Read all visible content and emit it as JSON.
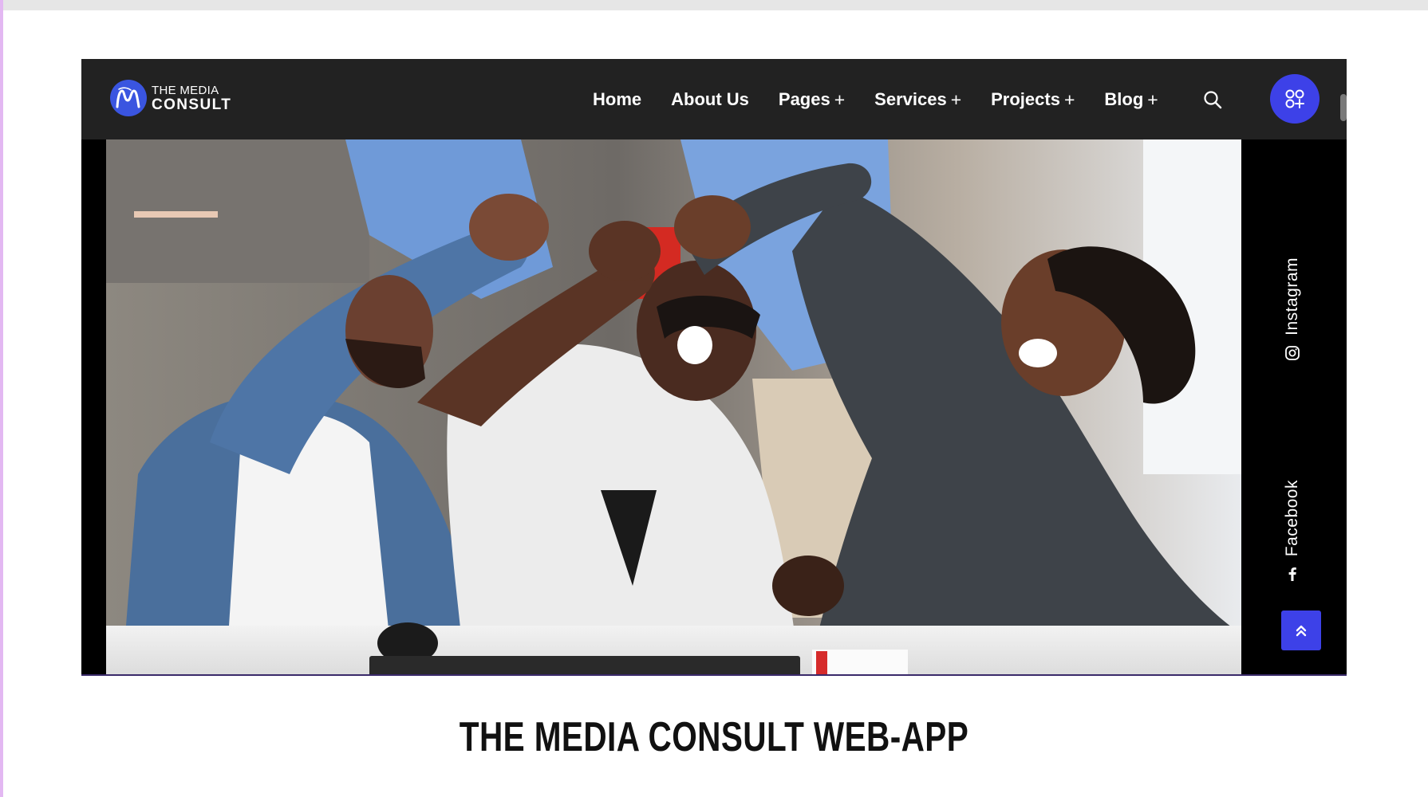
{
  "logo": {
    "line1": "THE MEDIA",
    "line2": "CONSULT",
    "mark_color": "#3a55e0",
    "icon": "logo-m-icon"
  },
  "nav": {
    "items": [
      {
        "label": "Home",
        "has_submenu": false
      },
      {
        "label": "About Us",
        "has_submenu": false
      },
      {
        "label": "Pages",
        "has_submenu": true
      },
      {
        "label": "Services",
        "has_submenu": true
      },
      {
        "label": "Projects",
        "has_submenu": true
      },
      {
        "label": "Blog",
        "has_submenu": true
      }
    ],
    "submenu_indicator": "+",
    "search_icon": "search-icon",
    "apps_icon": "apps-grid-icon",
    "accent_color": "#3d41e8",
    "bar_color": "#222222"
  },
  "social": {
    "links": [
      {
        "label": "Instagram",
        "icon": "instagram-icon"
      },
      {
        "label": "Facebook",
        "icon": "facebook-icon"
      }
    ]
  },
  "scroll_top": {
    "icon": "double-chevron-up-icon"
  },
  "caption": "THE MEDIA CONSULT WEB-APP"
}
